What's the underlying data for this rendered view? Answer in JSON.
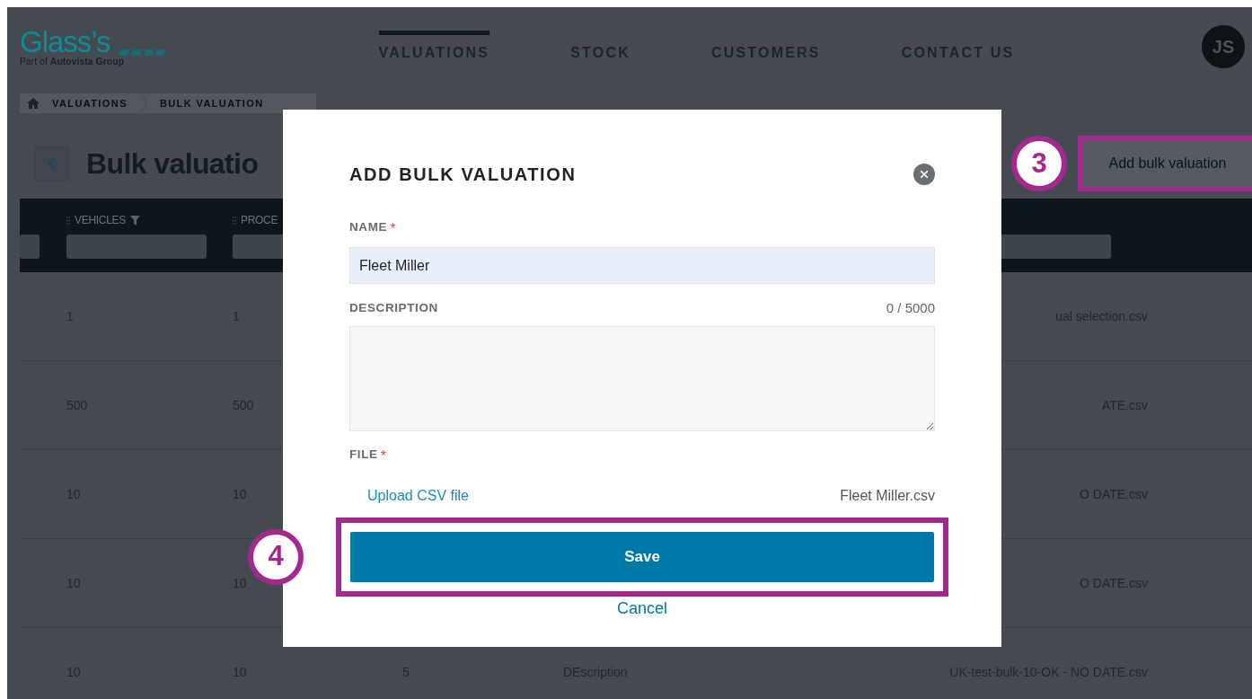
{
  "header": {
    "logo": {
      "name": "Glass’s",
      "tagline_prefix": "Part of",
      "tagline_brand": "Autovista Group"
    },
    "nav": [
      {
        "label": "VALUATIONS",
        "selected": true
      },
      {
        "label": "STOCK",
        "selected": false
      },
      {
        "label": "CUSTOMERS",
        "selected": false
      },
      {
        "label": "CONTACT US",
        "selected": false
      }
    ],
    "avatar": "JS"
  },
  "breadcrumb": [
    "VALUATIONS",
    "BULK VALUATION"
  ],
  "page": {
    "title": "Bulk valuatio",
    "action": "Add bulk valuation"
  },
  "table": {
    "columns": [
      {
        "label": "VEHICLES",
        "filter_icon": true
      },
      {
        "label": "PROCE",
        "filter_icon": false
      }
    ],
    "rows": [
      {
        "cells": [
          "1",
          "1"
        ],
        "file": "ual selection.csv"
      },
      {
        "cells": [
          "500",
          "500"
        ],
        "file": "ATE.csv"
      },
      {
        "cells": [
          "10",
          "10"
        ],
        "file": "O DATE.csv"
      },
      {
        "cells": [
          "10",
          "10"
        ],
        "file": "O DATE.csv"
      },
      {
        "cells": [
          "10",
          "10",
          "5",
          "DEscription"
        ],
        "file": "UK-test-bulk-10-OK - NO DATE.csv"
      }
    ]
  },
  "modal": {
    "title": "ADD BULK VALUATION",
    "name": {
      "label": "NAME",
      "required_mark": "*",
      "value": "Fleet Miller"
    },
    "description": {
      "label": "DESCRIPTION",
      "counter": "0 / 5000"
    },
    "file": {
      "label": "FILE",
      "required_mark": "*",
      "upload": "Upload CSV file",
      "filename": "Fleet Miller.csv"
    },
    "save": "Save",
    "cancel": "Cancel"
  },
  "annotations": [
    {
      "number": "3"
    },
    {
      "number": "4"
    }
  ]
}
